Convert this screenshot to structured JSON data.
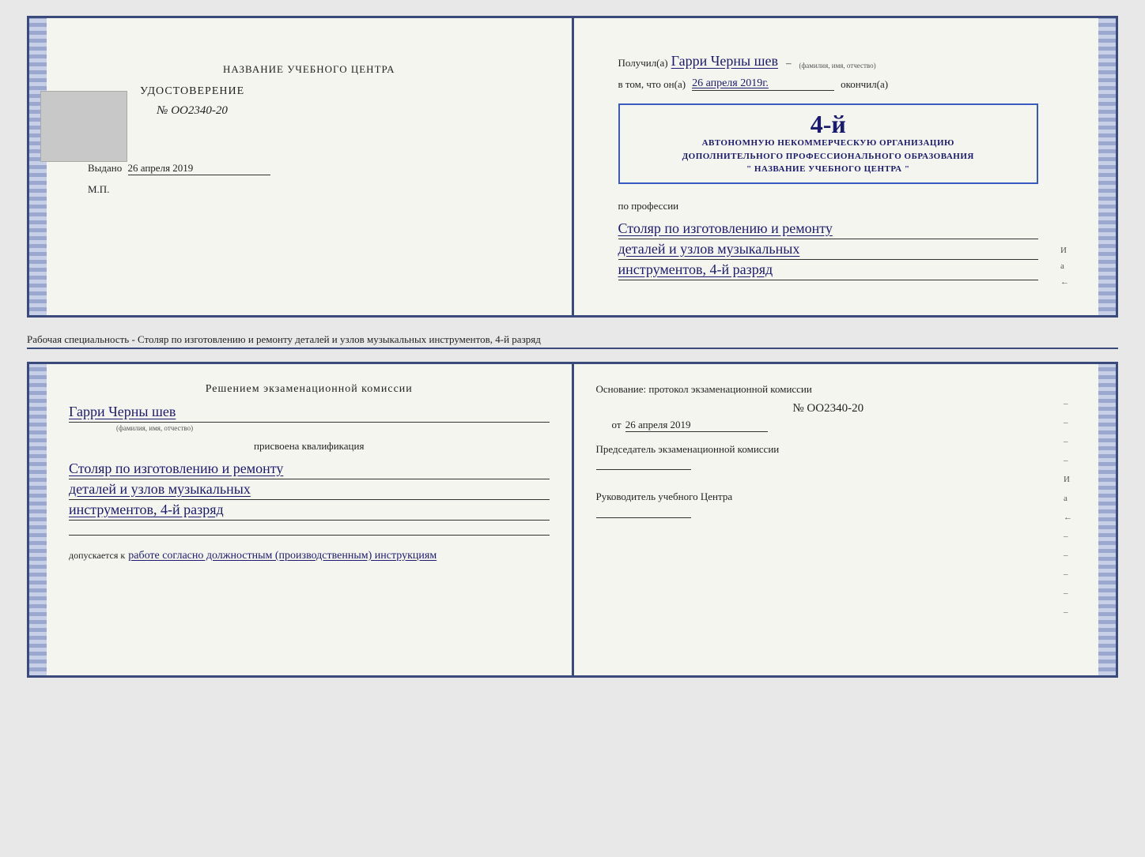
{
  "top_document": {
    "left_page": {
      "org_name": "НАЗВАНИЕ УЧЕБНОГО ЦЕНТРА",
      "photo_alt": "Фото",
      "udostoverenie_label": "УДОСТОВЕРЕНИЕ",
      "number_label": "№ OO2340-20",
      "vydano_label": "Выдано",
      "vydano_date": "26 апреля 2019",
      "mp_label": "М.П."
    },
    "right_page": {
      "poluchil_label": "Получил(а)",
      "recipient_name": "Гарри Черны шев",
      "fio_hint": "(фамилия, имя, отчество)",
      "vtom_chto_label": "в том, что он(а)",
      "date_value": "26 апреля 2019г.",
      "okonchil_label": "окончил(а)",
      "stamp_line1": "АВТОНОМНУЮ НЕКОММЕРЧЕСКУЮ ОРГАНИЗАЦИЮ",
      "stamp_line2": "ДОПОЛНИТЕЛЬНОГО ПРОФЕССИОНАЛЬНОГО ОБРАЗОВАНИЯ",
      "stamp_line3": "\" НАЗВАНИЕ УЧЕБНОГО ЦЕНТРА \"",
      "stamp_year": "4-й",
      "po_professii_label": "по профессии",
      "profession_line1": "Столяр по изготовлению и ремонту",
      "profession_line2": "деталей и узлов музыкальных",
      "profession_line3": "инструментов, 4-й разряд",
      "side_i": "И",
      "side_a": "а",
      "side_arrow": "←"
    }
  },
  "middle_caption": "Рабочая специальность - Столяр по изготовлению и ремонту деталей и узлов музыкальных инструментов, 4-й разряд",
  "bottom_document": {
    "left_page": {
      "resheniem_title": "Решением  экзаменационной  комиссии",
      "name_handwritten": "Гарри Черны шев",
      "fio_hint": "(фамилия, имя, отчество)",
      "prisvoena_label": "присвоена квалификация",
      "qualification_line1": "Столяр по изготовлению и ремонту",
      "qualification_line2": "деталей и узлов музыкальных",
      "qualification_line3": "инструментов, 4-й разряд",
      "dopuskaetsya_label": "допускается к",
      "dopuskaetsya_value": "работе согласно должностным (производственным) инструкциям"
    },
    "right_page": {
      "osnovanie_label": "Основание: протокол экзаменационной  комиссии",
      "number_label": "№  OO2340-20",
      "ot_label": "от",
      "ot_date": "26 апреля 2019",
      "predsedatel_label": "Председатель экзаменационной комиссии",
      "rukovoditel_label": "Руководитель учебного Центра",
      "side_i": "И",
      "side_a": "а",
      "side_arrow": "←",
      "dashes": [
        "–",
        "–",
        "–",
        "–",
        "–",
        "–",
        "–",
        "–",
        "–"
      ]
    }
  }
}
